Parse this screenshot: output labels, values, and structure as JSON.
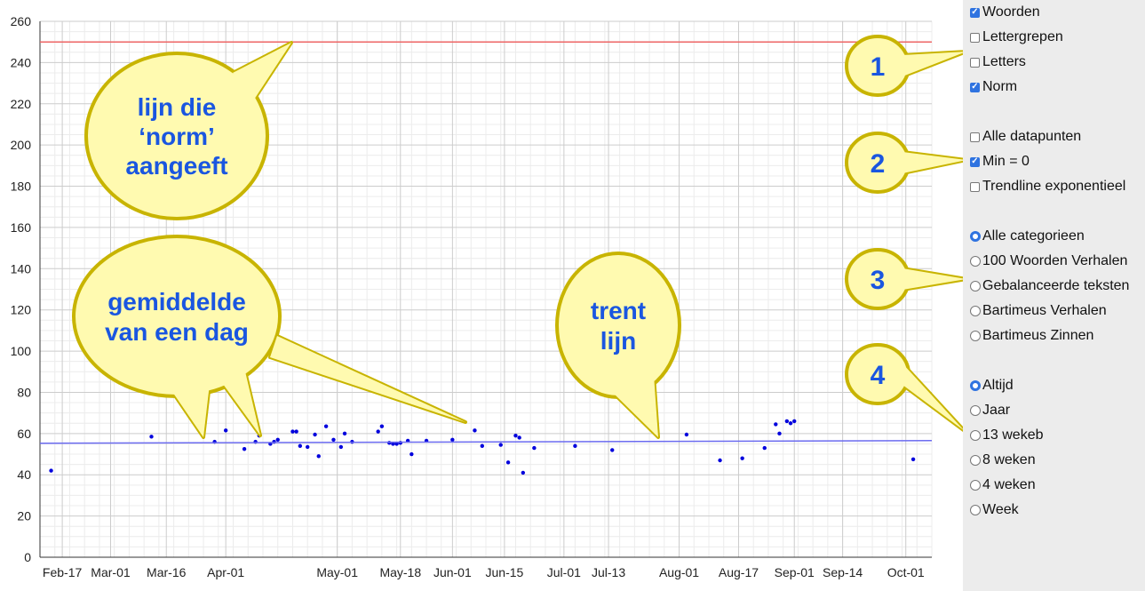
{
  "chart_data": {
    "type": "scatter",
    "title": "",
    "xlabel": "",
    "ylabel": "",
    "ylim": [
      0,
      260
    ],
    "yticks": [
      0,
      20,
      40,
      60,
      80,
      100,
      120,
      140,
      160,
      180,
      200,
      220,
      240,
      260
    ],
    "xlim": [
      "2024-02-11",
      "2024-10-08"
    ],
    "xticks": [
      {
        "label": "Feb-17",
        "date": "2024-02-17"
      },
      {
        "label": "Mar-01",
        "date": "2024-03-01"
      },
      {
        "label": "Mar-16",
        "date": "2024-03-16"
      },
      {
        "label": "Apr-01",
        "date": "2024-04-01"
      },
      {
        "label": "May-01",
        "date": "2024-05-01"
      },
      {
        "label": "May-18",
        "date": "2024-05-18"
      },
      {
        "label": "Jun-01",
        "date": "2024-06-01"
      },
      {
        "label": "Jun-15",
        "date": "2024-06-15"
      },
      {
        "label": "Jul-01",
        "date": "2024-07-01"
      },
      {
        "label": "Jul-13",
        "date": "2024-07-13"
      },
      {
        "label": "Aug-01",
        "date": "2024-08-01"
      },
      {
        "label": "Aug-17",
        "date": "2024-08-17"
      },
      {
        "label": "Sep-01",
        "date": "2024-09-01"
      },
      {
        "label": "Sep-14",
        "date": "2024-09-14"
      },
      {
        "label": "Oct-01",
        "date": "2024-10-01"
      }
    ],
    "grid": true,
    "series": [
      {
        "type": "scatter",
        "color": "#0000dd",
        "points": [
          {
            "x": "2024-02-14",
            "y": 42
          },
          {
            "x": "2024-03-12",
            "y": 58.5
          },
          {
            "x": "2024-03-29",
            "y": 56
          },
          {
            "x": "2024-04-01",
            "y": 61.5
          },
          {
            "x": "2024-04-06",
            "y": 52.5
          },
          {
            "x": "2024-04-09",
            "y": 56
          },
          {
            "x": "2024-04-10",
            "y": 59
          },
          {
            "x": "2024-04-13",
            "y": 55
          },
          {
            "x": "2024-04-14",
            "y": 56
          },
          {
            "x": "2024-04-15",
            "y": 57
          },
          {
            "x": "2024-04-19",
            "y": 61
          },
          {
            "x": "2024-04-20",
            "y": 61
          },
          {
            "x": "2024-04-21",
            "y": 54
          },
          {
            "x": "2024-04-23",
            "y": 53.5
          },
          {
            "x": "2024-04-25",
            "y": 59.5
          },
          {
            "x": "2024-04-26",
            "y": 49
          },
          {
            "x": "2024-04-28",
            "y": 63.5
          },
          {
            "x": "2024-04-30",
            "y": 57
          },
          {
            "x": "2024-05-02",
            "y": 53.5
          },
          {
            "x": "2024-05-03",
            "y": 60
          },
          {
            "x": "2024-05-05",
            "y": 56
          },
          {
            "x": "2024-05-12",
            "y": 61
          },
          {
            "x": "2024-05-13",
            "y": 63.5
          },
          {
            "x": "2024-05-15",
            "y": 55.5
          },
          {
            "x": "2024-05-16",
            "y": 55
          },
          {
            "x": "2024-05-17",
            "y": 55
          },
          {
            "x": "2024-05-18",
            "y": 55.5
          },
          {
            "x": "2024-05-20",
            "y": 56.5
          },
          {
            "x": "2024-05-21",
            "y": 50
          },
          {
            "x": "2024-05-25",
            "y": 56.5
          },
          {
            "x": "2024-06-01",
            "y": 57
          },
          {
            "x": "2024-06-07",
            "y": 61.5
          },
          {
            "x": "2024-06-09",
            "y": 54
          },
          {
            "x": "2024-06-14",
            "y": 54.5
          },
          {
            "x": "2024-06-16",
            "y": 46
          },
          {
            "x": "2024-06-18",
            "y": 59
          },
          {
            "x": "2024-06-19",
            "y": 58
          },
          {
            "x": "2024-06-20",
            "y": 41
          },
          {
            "x": "2024-06-23",
            "y": 53
          },
          {
            "x": "2024-07-04",
            "y": 54
          },
          {
            "x": "2024-07-14",
            "y": 52
          },
          {
            "x": "2024-08-03",
            "y": 59.5
          },
          {
            "x": "2024-08-12",
            "y": 47
          },
          {
            "x": "2024-08-18",
            "y": 48
          },
          {
            "x": "2024-08-24",
            "y": 53
          },
          {
            "x": "2024-08-27",
            "y": 64.5
          },
          {
            "x": "2024-08-28",
            "y": 60
          },
          {
            "x": "2024-08-30",
            "y": 66
          },
          {
            "x": "2024-08-31",
            "y": 65
          },
          {
            "x": "2024-09-01",
            "y": 66
          },
          {
            "x": "2024-10-03",
            "y": 47.5
          }
        ]
      },
      {
        "type": "line",
        "color": "#6b6bf0",
        "points": [
          {
            "x": "2024-02-11",
            "y": 55.3
          },
          {
            "x": "2024-10-08",
            "y": 56.6
          }
        ]
      },
      {
        "type": "line",
        "color": "#ee6666",
        "points": [
          {
            "x": "2024-02-11",
            "y": 250
          },
          {
            "x": "2024-10-08",
            "y": 250
          }
        ]
      }
    ]
  },
  "annotations": {
    "callout_norm": [
      "lijn die",
      "‘norm’",
      "aangeeft"
    ],
    "callout_average": [
      "gemiddelde",
      "van een dag"
    ],
    "callout_trend": [
      "trent",
      "lijn"
    ],
    "badges": [
      "1",
      "2",
      "3",
      "4"
    ]
  },
  "sidebar": {
    "group1": [
      {
        "label": "Woorden",
        "checked": true
      },
      {
        "label": "Lettergrepen",
        "checked": false
      },
      {
        "label": "Letters",
        "checked": false
      },
      {
        "label": "Norm",
        "checked": true
      }
    ],
    "group2": [
      {
        "label": "Alle datapunten",
        "checked": false
      },
      {
        "label": "Min = 0",
        "checked": true
      },
      {
        "label": "Trendline exponentieel",
        "checked": false
      }
    ],
    "group3": [
      {
        "label": "Alle categorieen",
        "selected": true
      },
      {
        "label": "100 Woorden Verhalen",
        "selected": false
      },
      {
        "label": "Gebalanceerde teksten",
        "selected": false
      },
      {
        "label": "Bartimeus Verhalen",
        "selected": false
      },
      {
        "label": "Bartimeus Zinnen",
        "selected": false
      }
    ],
    "group4": [
      {
        "label": "Altijd",
        "selected": true
      },
      {
        "label": "Jaar",
        "selected": false
      },
      {
        "label": "13 wekeb",
        "selected": false
      },
      {
        "label": "8 weken",
        "selected": false
      },
      {
        "label": "4 weken",
        "selected": false
      },
      {
        "label": "Week",
        "selected": false
      }
    ]
  },
  "colors": {
    "point": "#0000dd",
    "trendline": "#6b6bf0",
    "norm_line": "#ee6666",
    "callout_fill": "#fffab0",
    "callout_stroke": "#c8b400",
    "callout_text": "#1a56e0",
    "checkbox_on": "#2f73e0"
  }
}
